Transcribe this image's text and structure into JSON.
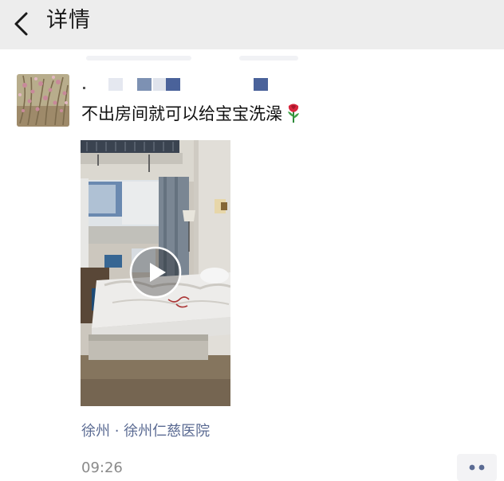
{
  "navbar": {
    "title": "详情",
    "back_icon": "chevron-left-icon"
  },
  "post": {
    "text": "不出房间就可以给宝宝洗澡",
    "emoji_icon": "rose-icon",
    "location": "徐州 · 徐州仁慈医院",
    "time": "09:26",
    "more_icon": "ellipsis-icon"
  },
  "colors": {
    "navbar_bg": "#ededed",
    "link_blue": "#5b6b93",
    "time_gray": "#8a8a8a"
  }
}
